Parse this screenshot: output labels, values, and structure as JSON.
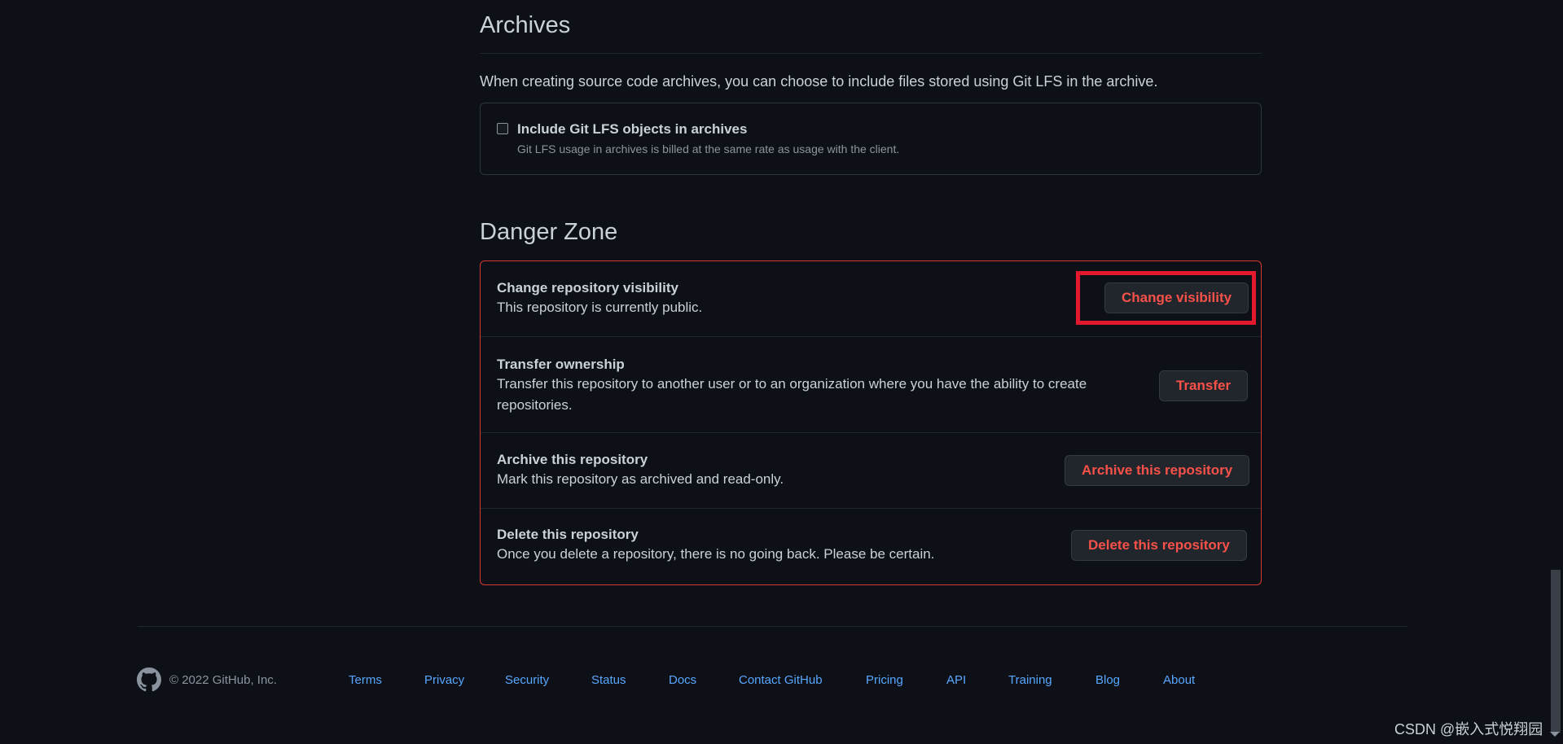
{
  "archives": {
    "title": "Archives",
    "description": "When creating source code archives, you can choose to include files stored using Git LFS in the archive.",
    "checkbox_label": "Include Git LFS objects in archives",
    "checkbox_note": "Git LFS usage in archives is billed at the same rate as usage with the client.",
    "checkbox_checked": false
  },
  "danger_zone": {
    "title": "Danger Zone",
    "rows": [
      {
        "title": "Change repository visibility",
        "text": "This repository is currently public.",
        "button": "Change visibility"
      },
      {
        "title": "Transfer ownership",
        "text": "Transfer this repository to another user or to an organization where you have the ability to create repositories.",
        "button": "Transfer"
      },
      {
        "title": "Archive this repository",
        "text": "Mark this repository as archived and read-only.",
        "button": "Archive this repository"
      },
      {
        "title": "Delete this repository",
        "text": "Once you delete a repository, there is no going back. Please be certain.",
        "button": "Delete this repository"
      }
    ]
  },
  "footer": {
    "copyright": "© 2022 GitHub, Inc.",
    "links": [
      "Terms",
      "Privacy",
      "Security",
      "Status",
      "Docs",
      "Contact GitHub",
      "Pricing",
      "API",
      "Training",
      "Blog",
      "About"
    ]
  },
  "watermark": "CSDN @嵌入式悦翔园",
  "colors": {
    "background": "#0d1117",
    "danger": "#f85149",
    "link": "#58a6ff",
    "highlight": "#e5192d"
  },
  "icons": {
    "footer_logo": "github-mark-icon"
  }
}
